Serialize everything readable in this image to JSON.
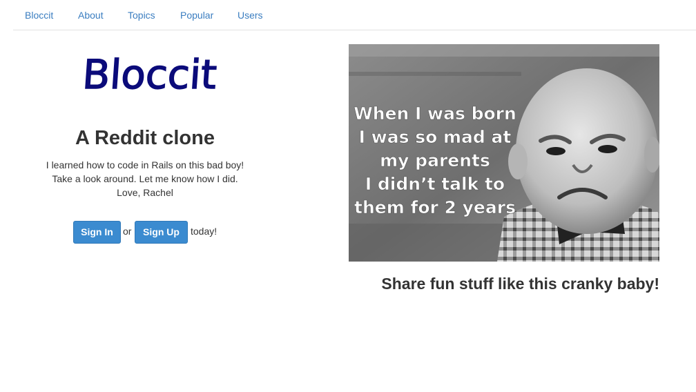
{
  "nav": {
    "items": [
      {
        "label": "Bloccit"
      },
      {
        "label": "About"
      },
      {
        "label": "Topics"
      },
      {
        "label": "Popular"
      },
      {
        "label": "Users"
      }
    ]
  },
  "logo_text": "Bloccit",
  "intro": {
    "title": "A Reddit clone",
    "lines": [
      "I learned how to code in Rails on this bad boy!",
      "Take a look around. Let me know how I did.",
      "Love, Rachel"
    ]
  },
  "auth": {
    "sign_in_label": "Sign In",
    "or_text": "or",
    "sign_up_label": "Sign Up",
    "suffix_text": "today!"
  },
  "meme": {
    "lines": [
      "When I was born",
      "I was so mad at",
      "my parents",
      "I didn’t talk to",
      "them for 2 years"
    ]
  },
  "caption": "Share fun stuff like this cranky baby!",
  "colors": {
    "link": "#3a7dc0",
    "button": "#3b8bd0",
    "logo": "#0b0b7a",
    "text": "#333333"
  }
}
